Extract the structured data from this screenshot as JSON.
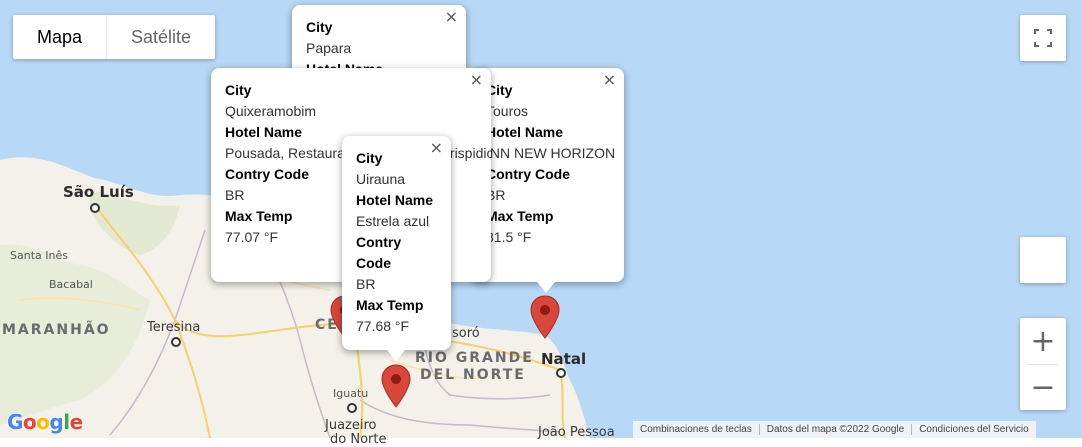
{
  "map_type": {
    "map_label": "Mapa",
    "satellite_label": "Satélite",
    "selected": "Mapa"
  },
  "places": {
    "sao_luis": "São Luís",
    "santa_ines": "Santa Inês",
    "bacabal": "Bacabal",
    "teresina": "Teresina",
    "maranhao": "MARANHÃO",
    "ceara": "CEA",
    "mossoro": "soró",
    "rio_grande_do_norte_1": "RIO GRANDE",
    "rio_grande_do_norte_2": "DEL NORTE",
    "natal": "Natal",
    "iguatu": "Iguatu",
    "juazeiro_1": "Juazeiro",
    "juazeiro_2": "do Norte",
    "joao_pessoa": "João Pessoa"
  },
  "info_windows": [
    {
      "id": "papara",
      "city_label": "City",
      "city": "Papara",
      "hotel_label": "Hotel Name"
    },
    {
      "id": "quixeramobim",
      "city_label": "City",
      "city": "Quixeramobim",
      "hotel_label": "Hotel Name",
      "hotel": "Pousada, Restaurante e Camping Crispidio",
      "country_label": "Contry Code",
      "country": "BR",
      "temp_label": "Max Temp",
      "temp": "77.07 °F"
    },
    {
      "id": "touros",
      "city_label": "City",
      "city": "Touros",
      "hotel_label": "Hotel Name",
      "hotel": "INN NEW HORIZON",
      "country_label": "Contry Code",
      "country": "BR",
      "temp_label": "Max Temp",
      "temp": "81.5 °F"
    },
    {
      "id": "uirauna",
      "city_label": "City",
      "city": "Uirauna",
      "hotel_label": "Hotel Name",
      "hotel": "Estrela azul",
      "country_label": "Contry Code",
      "country": "BR",
      "temp_label": "Max Temp",
      "temp": "77.68 °F"
    }
  ],
  "close_glyph": "×",
  "zoom": {
    "in_label": "+",
    "out_label": "−"
  },
  "attribution": {
    "shortcuts": "Combinaciones de teclas",
    "map_data": "Datos del mapa ©2022 Google",
    "terms": "Condiciones del Servicio"
  },
  "logo": "Google",
  "colors": {
    "ocean": "#aadaff",
    "land": "#f3f1ea",
    "marker": "#ea4335",
    "state_border": "#c4b7c9",
    "road": "#f6c453"
  },
  "icons": {
    "fullscreen": "fullscreen-icon",
    "pegman": "pegman-icon",
    "marker": "map-marker-icon"
  }
}
